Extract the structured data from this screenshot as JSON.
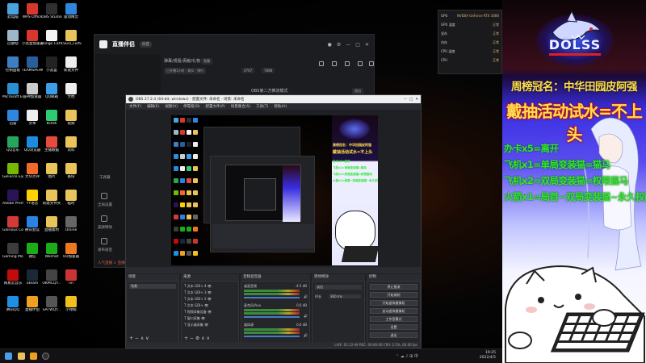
{
  "desktop": {
    "icons": [
      {
        "label": "此电脑",
        "color": "#4aa3df"
      },
      {
        "label": "回收站",
        "color": "#9bb7c9"
      },
      {
        "label": "控制面板",
        "color": "#3d7fc1"
      },
      {
        "label": "Microsoft Edge",
        "color": "#2b8fd6"
      },
      {
        "label": "迅雷",
        "color": "#2e86de"
      },
      {
        "label": "QQ音乐",
        "color": "#26a65b"
      },
      {
        "label": "GeForce Experience",
        "color": "#76b900"
      },
      {
        "label": "Adobe Premie...",
        "color": "#2a1457"
      },
      {
        "label": "Glorious Core",
        "color": "#d23a3a"
      },
      {
        "label": "Gaming Mouse",
        "color": "#3c3c3c"
      },
      {
        "label": "网易云音乐",
        "color": "#c20c0c"
      },
      {
        "label": "腾讯QQ",
        "color": "#1e8fe1"
      },
      {
        "label": "WPS Office",
        "color": "#d8372d"
      },
      {
        "label": "小黑盒加速器",
        "color": "#d8372d"
      },
      {
        "label": "TEAMSPEAK",
        "color": "#2a5d9b"
      },
      {
        "label": "雷神加速器",
        "color": "#cccccc"
      },
      {
        "label": "文本",
        "color": "#eeeeee"
      },
      {
        "label": "QQ浏览器",
        "color": "#1d8be0"
      },
      {
        "label": "大众点评",
        "color": "#f06a2a"
      },
      {
        "label": "YY语音",
        "color": "#ffd100"
      },
      {
        "label": "腾讯会议",
        "color": "#2a82e4"
      },
      {
        "label": "微信",
        "color": "#1aad19"
      },
      {
        "label": "Steam",
        "color": "#1b2838"
      },
      {
        "label": "直播伴侣",
        "color": "#f0a020"
      },
      {
        "label": "OBS Studio",
        "color": "#302e31"
      },
      {
        "label": "Bongo Cat Mver",
        "color": "#f5f5f5"
      },
      {
        "label": "小黑盒",
        "color": "#222222"
      },
      {
        "label": "QQ邮箱",
        "color": "#3b9eea"
      },
      {
        "label": "KOOK",
        "color": "#2fcb72"
      },
      {
        "label": "主播数据",
        "color": "#e64a3c"
      },
      {
        "label": "图片",
        "color": "#e8c45a"
      },
      {
        "label": "新建文件夹",
        "color": "#e8c45a"
      },
      {
        "label": "直播素材",
        "color": "#e8c45a"
      },
      {
        "label": "Wechat",
        "color": "#1aad19"
      },
      {
        "label": "OKMCQY...",
        "color": "#444444"
      },
      {
        "label": "SATWQY...",
        "color": "#555555"
      },
      {
        "label": "驱动精灵",
        "color": "#2e86de"
      },
      {
        "label": "CSGO_FullS...",
        "color": "#e8c45a"
      },
      {
        "label": "新建文件",
        "color": "#eeeeee"
      },
      {
        "label": "文档",
        "color": "#eeeeee"
      },
      {
        "label": "视频",
        "color": "#e8c45a"
      },
      {
        "label": "资料",
        "color": "#e8c45a"
      },
      {
        "label": "备份",
        "color": "#e8c45a"
      },
      {
        "label": "临时",
        "color": "#e8c45a"
      },
      {
        "label": "Online",
        "color": "#666666"
      },
      {
        "label": "UU加速器",
        "color": "#ee7722"
      },
      {
        "label": "nn",
        "color": "#cc3333"
      },
      {
        "label": "小绿鲸",
        "color": "#f0c020"
      }
    ]
  },
  "assistant": {
    "brand": "直播伴侣",
    "tag": "抖音",
    "title": "弹幕/观看/贡献/礼物",
    "badge": "直播",
    "status_text": "已开播1小时 · 观众 · 排行",
    "stat1": "4767",
    "stat2": "7888",
    "screen_mode_label": "OBS第二方推流模式",
    "help_label": "退出",
    "side_items": [
      "工具箱",
      "全局设置",
      "美颜特效",
      "发布语音",
      "直播间管理"
    ],
    "footer": "人气直播 × 直播加速中"
  },
  "obs": {
    "title": "OBS 27.2.4 (64-bit, windows) - 配置文件: 未命名 - 场景: 未命名",
    "menu": [
      "文件(F)",
      "编辑(E)",
      "视图(V)",
      "停靠窗(D)",
      "配置文件(P)",
      "场景集合(S)",
      "工具(T)",
      "帮助(H)"
    ],
    "dock_titles": [
      "场景",
      "来源",
      "音频混音器",
      "转场特效",
      "控制"
    ],
    "scene": "场景",
    "sources": [
      "文本 GDI+ 4",
      "文本 GDI+ 3",
      "文本 GDI+ 2",
      "文本 GDI+",
      "视频采集设备",
      "窗口采集",
      "显示器采集"
    ],
    "mixer": [
      {
        "name": "桌面音频",
        "db": "-4.5 dB"
      },
      {
        "name": "麦克风/Aux",
        "db": "0.0 dB"
      },
      {
        "name": "媒体源",
        "db": "0.0 dB"
      }
    ],
    "transition": {
      "type": "淡出",
      "duration_label": "时长",
      "duration": "300 ms"
    },
    "controls": [
      "停止推流",
      "开始录制",
      "开始虚拟摄像机",
      "启动虚拟摄像机",
      "工作室模式",
      "设置",
      "退出"
    ],
    "status": "LIVE: 01:12:49   REC: 00:00:00   CPU: 2.5%, 60.00 fps"
  },
  "taskbar": {
    "time": "19:25",
    "date": "2022/4/5",
    "apps": [
      "start",
      "search",
      "taskview",
      "explorer",
      "obs",
      "chrome",
      "assistant"
    ]
  },
  "notif": {
    "rows": [
      {
        "k": "GPU",
        "v": "NVIDIA GeForce RTX 3080"
      },
      {
        "k": "GPU 温度",
        "v": "正常"
      },
      {
        "k": "显存",
        "v": "正常"
      },
      {
        "k": "内存",
        "v": "正常"
      },
      {
        "k": "CPU 温度",
        "v": "正常"
      },
      {
        "k": "CPU",
        "v": "正常"
      }
    ]
  },
  "overlay": {
    "logo_text": "DOLSS",
    "line1": "周榜冠名：中华田园皮阿强",
    "line2": "戴抽活动试水=不上头",
    "items": [
      "办卡x5=离开",
      "飞机x1=单局变装猫=猫马",
      "飞机x2=双局变装猫=权限猫马",
      "火箭x1=局首~双局变装猫~永久权限猫马"
    ],
    "accent_yellow": "#ffe14a",
    "accent_green": "#2ee82e",
    "accent_red": "#c0102a"
  }
}
